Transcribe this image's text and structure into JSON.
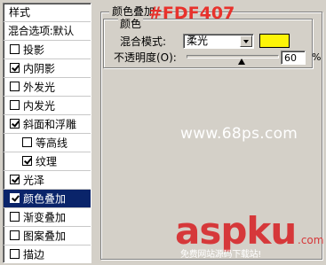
{
  "styles_panel": {
    "header": "样式",
    "blend_options": "混合选项:默认",
    "items": [
      {
        "label": "投影",
        "checked": false,
        "level": 0,
        "selected": false
      },
      {
        "label": "内阴影",
        "checked": true,
        "level": 0,
        "selected": false
      },
      {
        "label": "外发光",
        "checked": false,
        "level": 0,
        "selected": false
      },
      {
        "label": "内发光",
        "checked": false,
        "level": 0,
        "selected": false
      },
      {
        "label": "斜面和浮雕",
        "checked": true,
        "level": 0,
        "selected": false
      },
      {
        "label": "等高线",
        "checked": false,
        "level": 1,
        "selected": false
      },
      {
        "label": "纹理",
        "checked": true,
        "level": 1,
        "selected": false
      },
      {
        "label": "光泽",
        "checked": true,
        "level": 0,
        "selected": false
      },
      {
        "label": "颜色叠加",
        "checked": true,
        "level": 0,
        "selected": true
      },
      {
        "label": "渐变叠加",
        "checked": false,
        "level": 0,
        "selected": false
      },
      {
        "label": "图案叠加",
        "checked": false,
        "level": 0,
        "selected": false
      },
      {
        "label": "描边",
        "checked": false,
        "level": 0,
        "selected": false
      }
    ]
  },
  "color_overlay": {
    "group_title": "颜色叠加",
    "inner_title": "颜色",
    "blend_mode_label": "混合模式:",
    "blend_mode_value": "柔光",
    "swatch_color": "#FDF407",
    "opacity_label": "不透明度(O):",
    "opacity_value": "60",
    "opacity_unit": "%",
    "opacity_fraction": 0.6
  },
  "annotation": {
    "hex_label": "#FDF407",
    "hex_color": "#e8322c"
  },
  "watermarks": {
    "site": "www.68ps.com",
    "brand": "aspku",
    "brand_suffix": ".com",
    "slogan": "免费网站源码下载站!"
  }
}
